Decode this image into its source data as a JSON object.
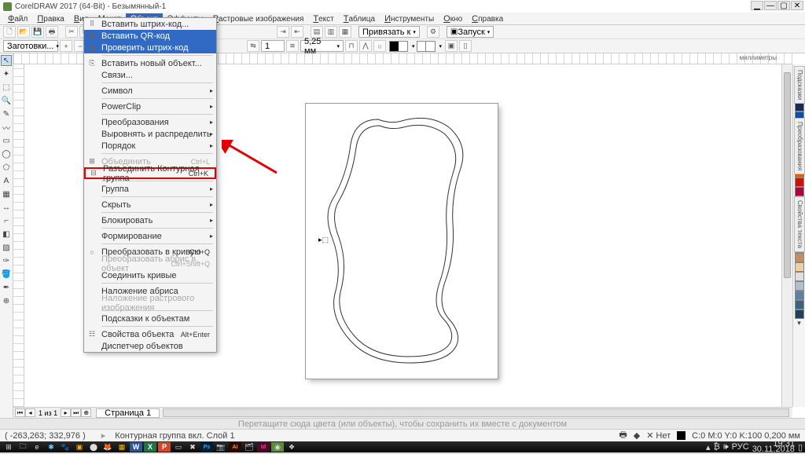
{
  "app": {
    "title": "CorelDRAW 2017 (64-Bit) - Безымянный-1"
  },
  "menubar": [
    "Файл",
    "Правка",
    "Вид",
    "Макет",
    "Объект",
    "Эффекты",
    "Растровые изображения",
    "Текст",
    "Таблица",
    "Инструменты",
    "Окно",
    "Справка"
  ],
  "menubar_open_index": 4,
  "toolbar1": {
    "snap": "Привязать к",
    "launch": "Запуск"
  },
  "toolbar2": {
    "combo1": "Заготовки...",
    "stroke_width": "5,25 мм",
    "page_spinner": "1"
  },
  "doc_tab": "Безымянный-1",
  "units": "миллиметры",
  "dropdown": {
    "items": [
      {
        "label": "Вставить штрих-код...",
        "icon": "⠿"
      },
      {
        "label": "Вставить QR-код",
        "icon": "▦",
        "highlight": true
      },
      {
        "label": "Проверить штрих-код",
        "icon": "▦",
        "highlight": true
      },
      {
        "sep": true
      },
      {
        "label": "Вставить новый объект...",
        "icon": "⎘"
      },
      {
        "label": "Связи..."
      },
      {
        "sep": true
      },
      {
        "label": "Символ",
        "sub": true
      },
      {
        "sep": true
      },
      {
        "label": "PowerClip",
        "sub": true
      },
      {
        "sep": true
      },
      {
        "label": "Преобразования",
        "sub": true
      },
      {
        "label": "Выровнять и распределить",
        "sub": true
      },
      {
        "label": "Порядок",
        "sub": true
      },
      {
        "sep": true
      },
      {
        "label": "Объединить",
        "shortcut": "Ctrl+L",
        "disabled": true,
        "icon": "⊞"
      },
      {
        "label": "Разъединить Контурная группа",
        "shortcut": "Ctrl+K",
        "icon": "⊟",
        "red": true
      },
      {
        "sep": true
      },
      {
        "label": "Группа",
        "sub": true
      },
      {
        "sep": true
      },
      {
        "label": "Скрыть",
        "sub": true
      },
      {
        "sep": true
      },
      {
        "label": "Блокировать",
        "sub": true
      },
      {
        "sep": true
      },
      {
        "label": "Формирование",
        "sub": true
      },
      {
        "sep": true
      },
      {
        "label": "Преобразовать в кривую",
        "shortcut": "Ctrl+Q",
        "icon": "○"
      },
      {
        "label": "Преобразовать абрис в объект",
        "shortcut": "Ctrl+Shift+Q",
        "disabled": true
      },
      {
        "label": "Соединить кривые"
      },
      {
        "sep": true
      },
      {
        "label": "Наложение абриса"
      },
      {
        "label": "Наложение растрового изображения",
        "disabled": true
      },
      {
        "sep": true
      },
      {
        "label": "Подсказки к объектам"
      },
      {
        "sep": true
      },
      {
        "label": "Свойства объекта",
        "shortcut": "Alt+Enter",
        "icon": "☷"
      },
      {
        "label": "Диспетчер объектов"
      }
    ]
  },
  "page_nav": {
    "counter": "1 из 1",
    "tab": "Страница 1"
  },
  "hint": "Перетащите сюда цвета (или объекты), чтобы сохранить их вместе с документом",
  "status": {
    "coords": "( -263,263; 332,976 )",
    "sel": "Контурная группа вкл. Слой 1",
    "fill": "Нет",
    "cmyk": "C:0 M:0 Y:0 K:100  0,200 мм"
  },
  "palette": [
    "#ffffff",
    "#000000",
    "#1a2a5a",
    "#0050b0",
    "#00a0e0",
    "#00a060",
    "#60c030",
    "#d0d000",
    "#f0a000",
    "#e06000",
    "#d01000",
    "#b00040",
    "#800080",
    "#c080c0",
    "#a0a0a0",
    "#606060",
    "#303030",
    "#8a5a3a",
    "#c09060",
    "#f0d0a0",
    "#e0e0e0",
    "#b0c0d0",
    "#6080a0",
    "#406080",
    "#204060"
  ],
  "right_tabs": [
    "Подсказки",
    "Преобразования",
    "Свойства текста"
  ],
  "tray": {
    "lang": "РУС",
    "time": "19:31",
    "date": "30.11.2018"
  }
}
